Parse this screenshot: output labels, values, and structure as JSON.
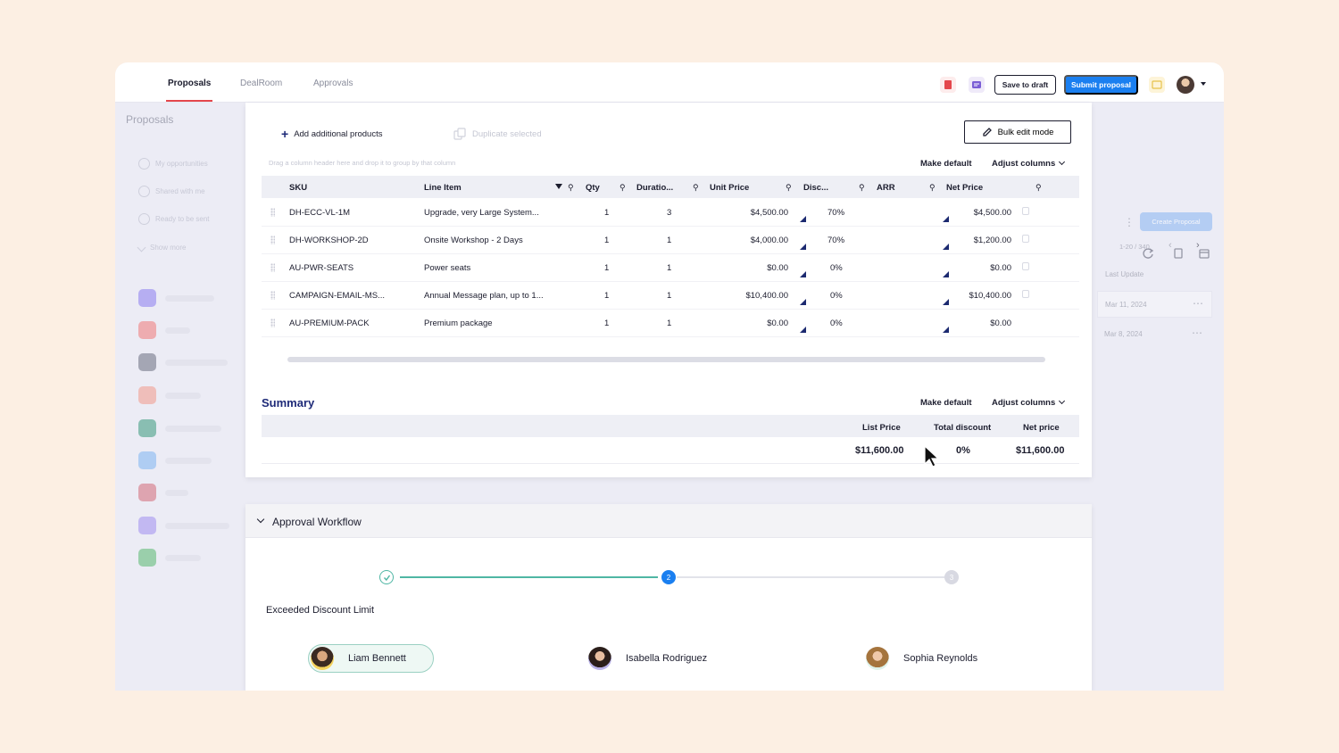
{
  "tabs": [
    {
      "label": "Proposals",
      "active": true
    },
    {
      "label": "DealRoom",
      "active": false
    },
    {
      "label": "Approvals",
      "active": false
    }
  ],
  "topbar": {
    "save_draft": "Save to draft",
    "submit": "Submit proposal",
    "icons": [
      "pdf-icon",
      "comment-icon",
      "notes-icon"
    ]
  },
  "sidebar": {
    "title": "Proposals",
    "items": [
      "My opportunities",
      "Shared with me",
      "Ready to be sent",
      "Show more"
    ]
  },
  "toolbar": {
    "add_products": "Add additional products",
    "duplicate": "Duplicate selected",
    "bulk_edit": "Bulk edit mode",
    "hint": "Drag a column header here and drop it to group by that column",
    "make_default": "Make default",
    "adjust_columns": "Adjust columns"
  },
  "table": {
    "columns": [
      "SKU",
      "Line Item",
      "Qty",
      "Duratio...",
      "Unit Price",
      "Disc...",
      "ARR",
      "Net Price"
    ],
    "rows": [
      {
        "sku": "DH-ECC-VL-1M",
        "item": "Upgrade, very Large System...",
        "qty": "1",
        "duration": "3",
        "unit_price": "$4,500.00",
        "disc": "70%",
        "arr": "",
        "net": "$4,500.00"
      },
      {
        "sku": "DH-WORKSHOP-2D",
        "item": "Onsite Workshop - 2 Days",
        "qty": "1",
        "duration": "1",
        "unit_price": "$4,000.00",
        "disc": "70%",
        "arr": "",
        "net": "$1,200.00"
      },
      {
        "sku": "AU-PWR-SEATS",
        "item": "Power seats",
        "qty": "1",
        "duration": "1",
        "unit_price": "$0.00",
        "disc": "0%",
        "arr": "",
        "net": "$0.00"
      },
      {
        "sku": "CAMPAIGN-EMAIL-MS...",
        "item": "Annual Message plan, up to 1...",
        "qty": "1",
        "duration": "1",
        "unit_price": "$10,400.00",
        "disc": "0%",
        "arr": "",
        "net": "$10,400.00"
      },
      {
        "sku": "AU-PREMIUM-PACK",
        "item": "Premium package",
        "qty": "1",
        "duration": "1",
        "unit_price": "$0.00",
        "disc": "0%",
        "arr": "",
        "net": "$0.00"
      }
    ]
  },
  "summary": {
    "title": "Summary",
    "make_default": "Make default",
    "adjust_columns": "Adjust columns",
    "columns": [
      "List Price",
      "Total discount",
      "Net price"
    ],
    "values": [
      "$11,600.00",
      "0%",
      "$11,600.00"
    ]
  },
  "right_panel": {
    "create": "Create Proposal",
    "pager": "1-20 / 340",
    "last_update": "Last Update",
    "dates": [
      "Mar 11, 2024",
      "Mar 8, 2024"
    ]
  },
  "workflow": {
    "title": "Approval Workflow",
    "steps": [
      "",
      "2",
      "3"
    ],
    "label": "Exceeded Discount Limit",
    "approvers": [
      "Liam Bennett",
      "Isabella Rodriguez",
      "Sophia Reynolds"
    ]
  },
  "colors": {
    "accent": "#1a7ff0",
    "tab_underline": "#e4474c",
    "summary_title": "#1e2a78",
    "step_done": "#4fb6a4",
    "step_active": "#1a7ff0"
  }
}
